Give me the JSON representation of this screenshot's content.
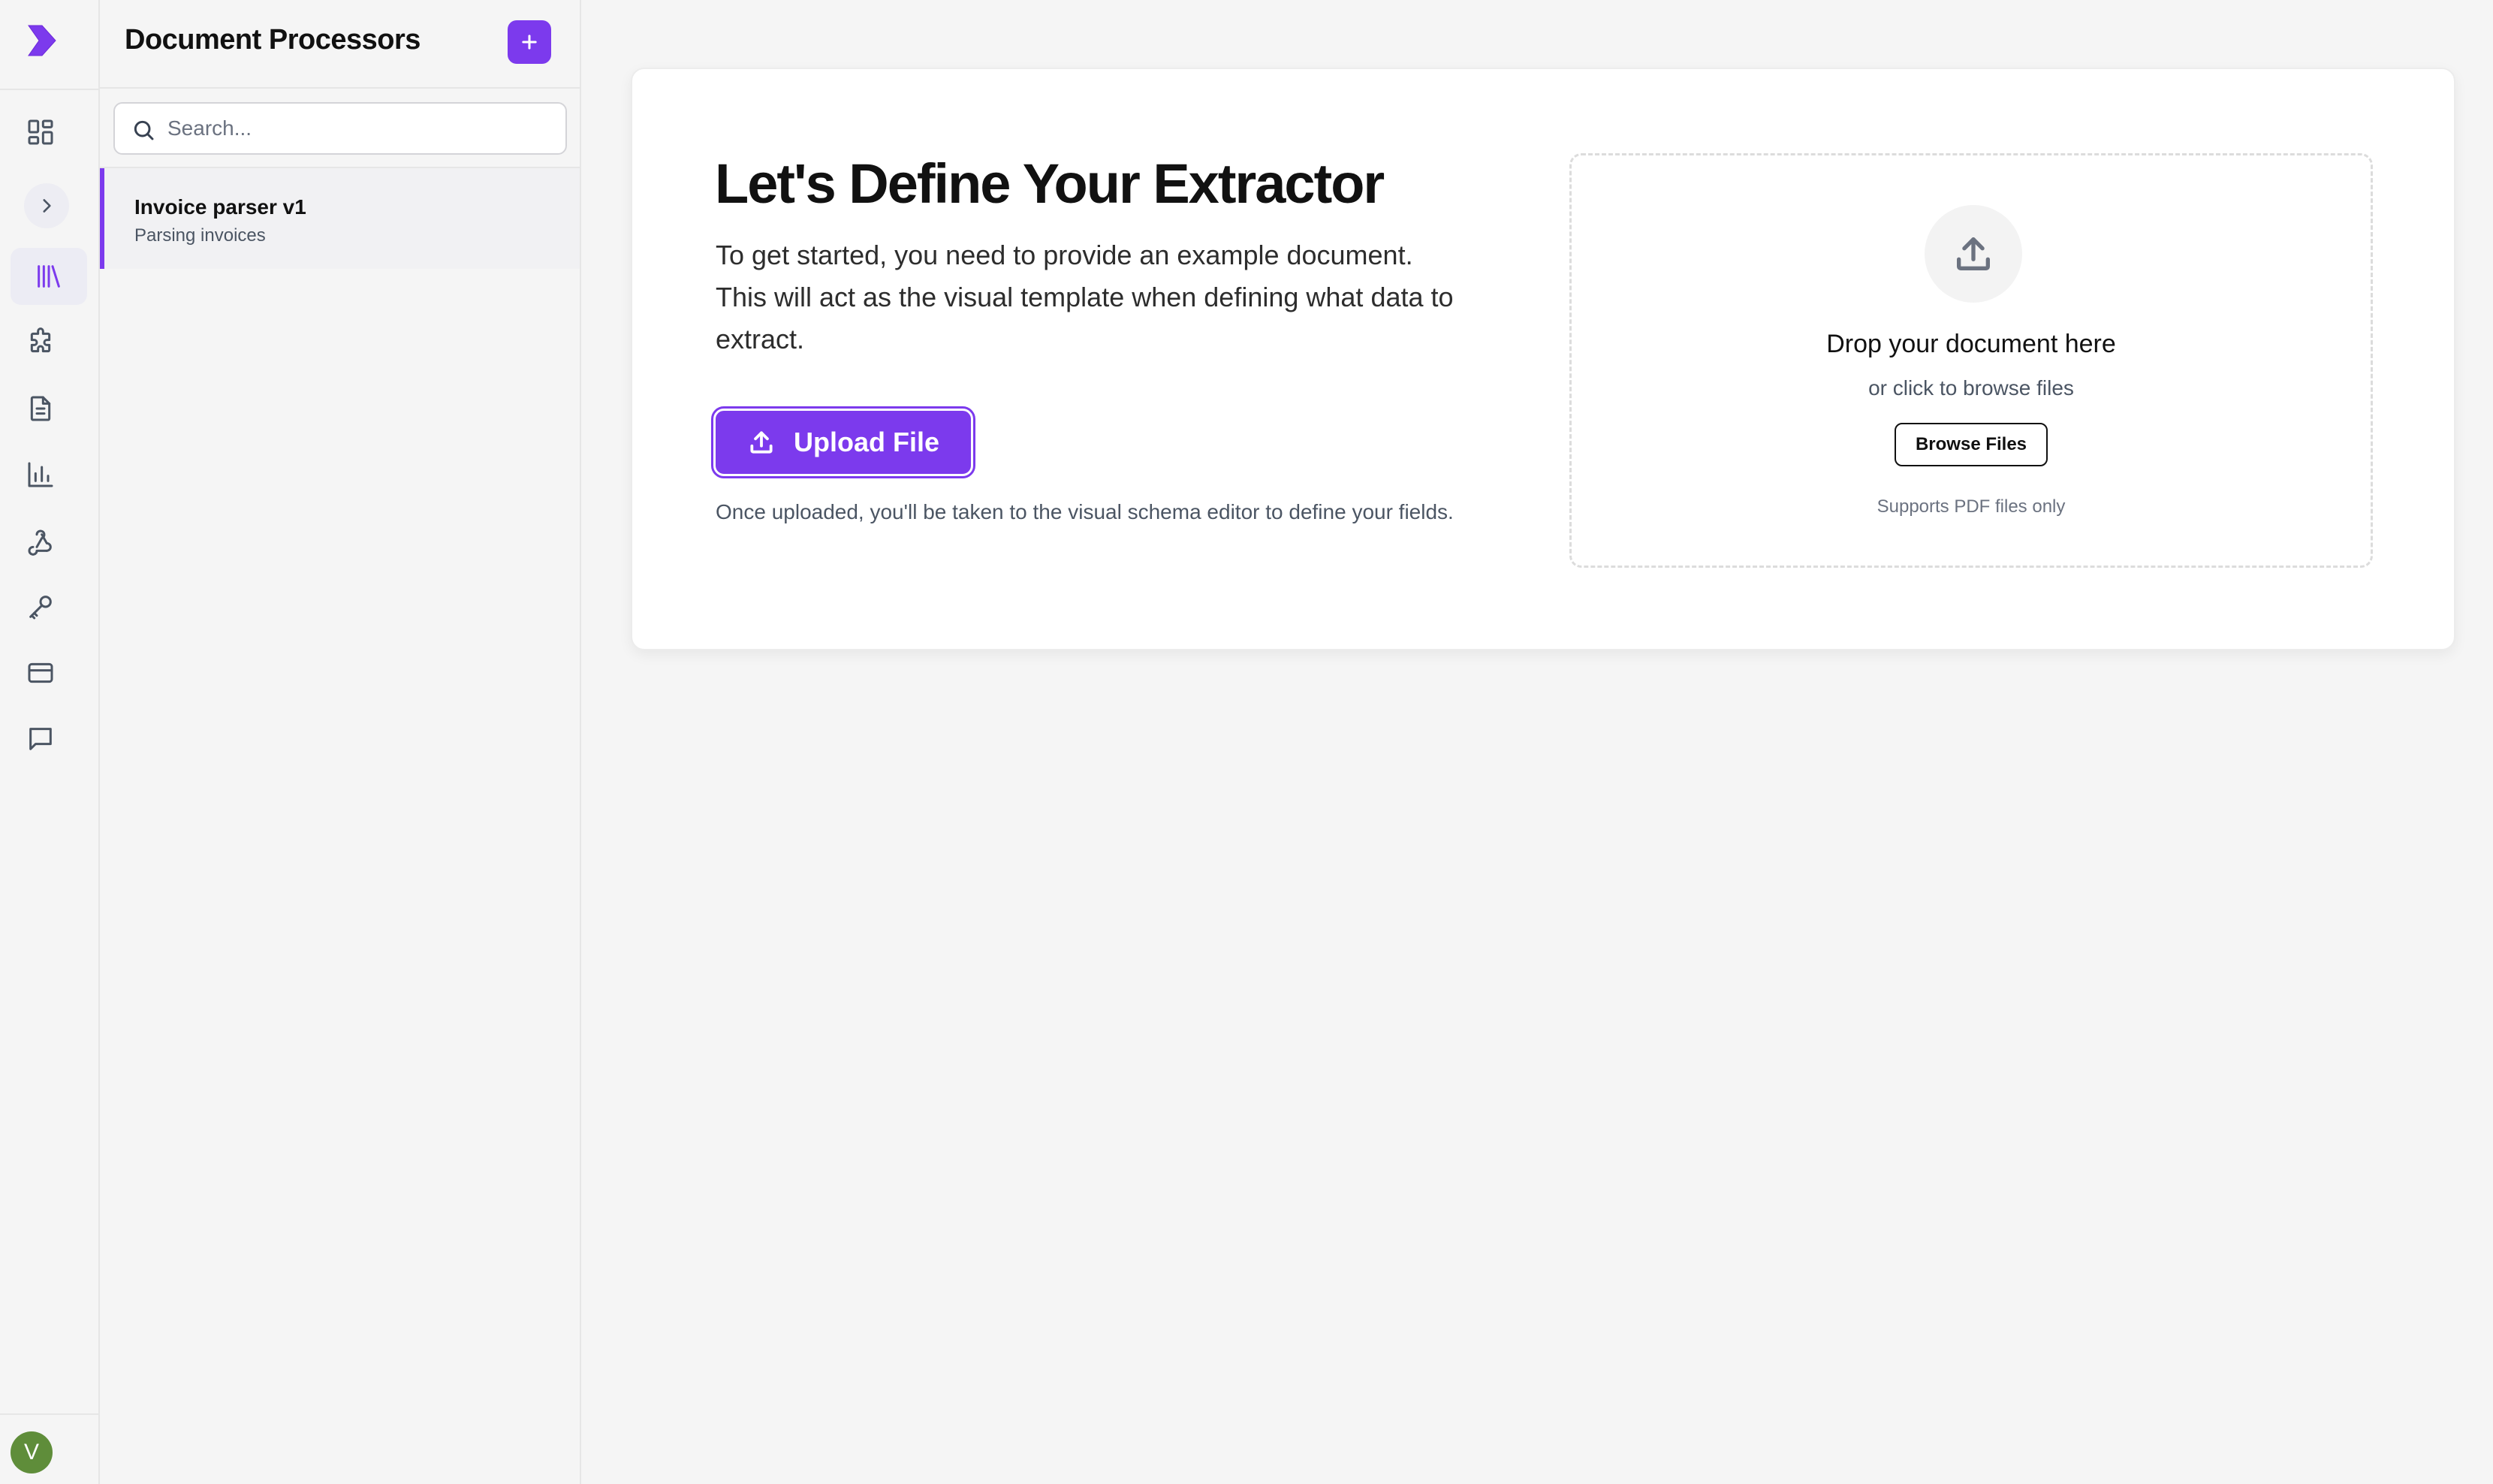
{
  "colors": {
    "accent": "#7c3aed",
    "avatar_bg": "#5f8d3a",
    "background": "#f5f5f5"
  },
  "rail": {
    "logo_icon": "brand-chevron-logo",
    "items": [
      {
        "icon": "dashboard-grid-icon"
      },
      {
        "icon": "library-icon",
        "active": true
      },
      {
        "icon": "puzzle-icon"
      },
      {
        "icon": "document-icon"
      },
      {
        "icon": "bar-chart-icon"
      },
      {
        "icon": "webhook-icon"
      },
      {
        "icon": "key-icon"
      },
      {
        "icon": "credit-card-icon"
      },
      {
        "icon": "chat-icon"
      }
    ],
    "expand_icon": "chevron-right-icon",
    "avatar_initial": "V"
  },
  "panel": {
    "title": "Document Processors",
    "add_icon": "plus-icon",
    "search": {
      "placeholder": "Search...",
      "value": ""
    },
    "items": [
      {
        "title": "Invoice parser v1",
        "subtitle": "Parsing invoices",
        "selected": true
      }
    ]
  },
  "main": {
    "headline": "Let's Define Your Extractor",
    "description": "To get started, you need to provide an example document. This will act as the visual template when defining what data to extract.",
    "upload_button": "Upload File",
    "hint": "Once uploaded, you'll be taken to the visual schema editor to define your fields.",
    "dropzone": {
      "title": "Drop your document here",
      "subtitle": "or click to browse files",
      "browse_button": "Browse Files",
      "note": "Supports PDF files only"
    }
  }
}
